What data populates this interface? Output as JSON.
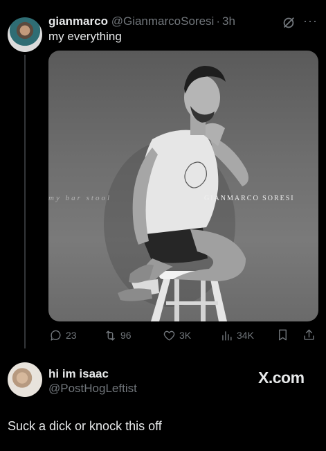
{
  "tweet": {
    "author_name": "gianmarco",
    "author_handle": "@GianmarcoSoresi",
    "separator": "·",
    "time": "3h",
    "text": "my everything",
    "media": {
      "album_title": "my bar stool",
      "album_artist": "GIANMARCO SORESI"
    },
    "actions": {
      "replies": "23",
      "retweets": "96",
      "likes": "3K",
      "views": "34K"
    },
    "icons": [
      "grok-icon",
      "more-icon",
      "reply-icon",
      "retweet-icon",
      "like-icon",
      "views-icon",
      "bookmark-icon",
      "share-icon"
    ]
  },
  "quote_user": {
    "name": "hi im isaac",
    "handle": "@PostHogLeftist"
  },
  "watermark": "X.com",
  "caption": "Suck a dick or knock this off",
  "colors": {
    "background": "#000000",
    "primary_text": "#e7e9ea",
    "secondary_text": "#71767b"
  }
}
